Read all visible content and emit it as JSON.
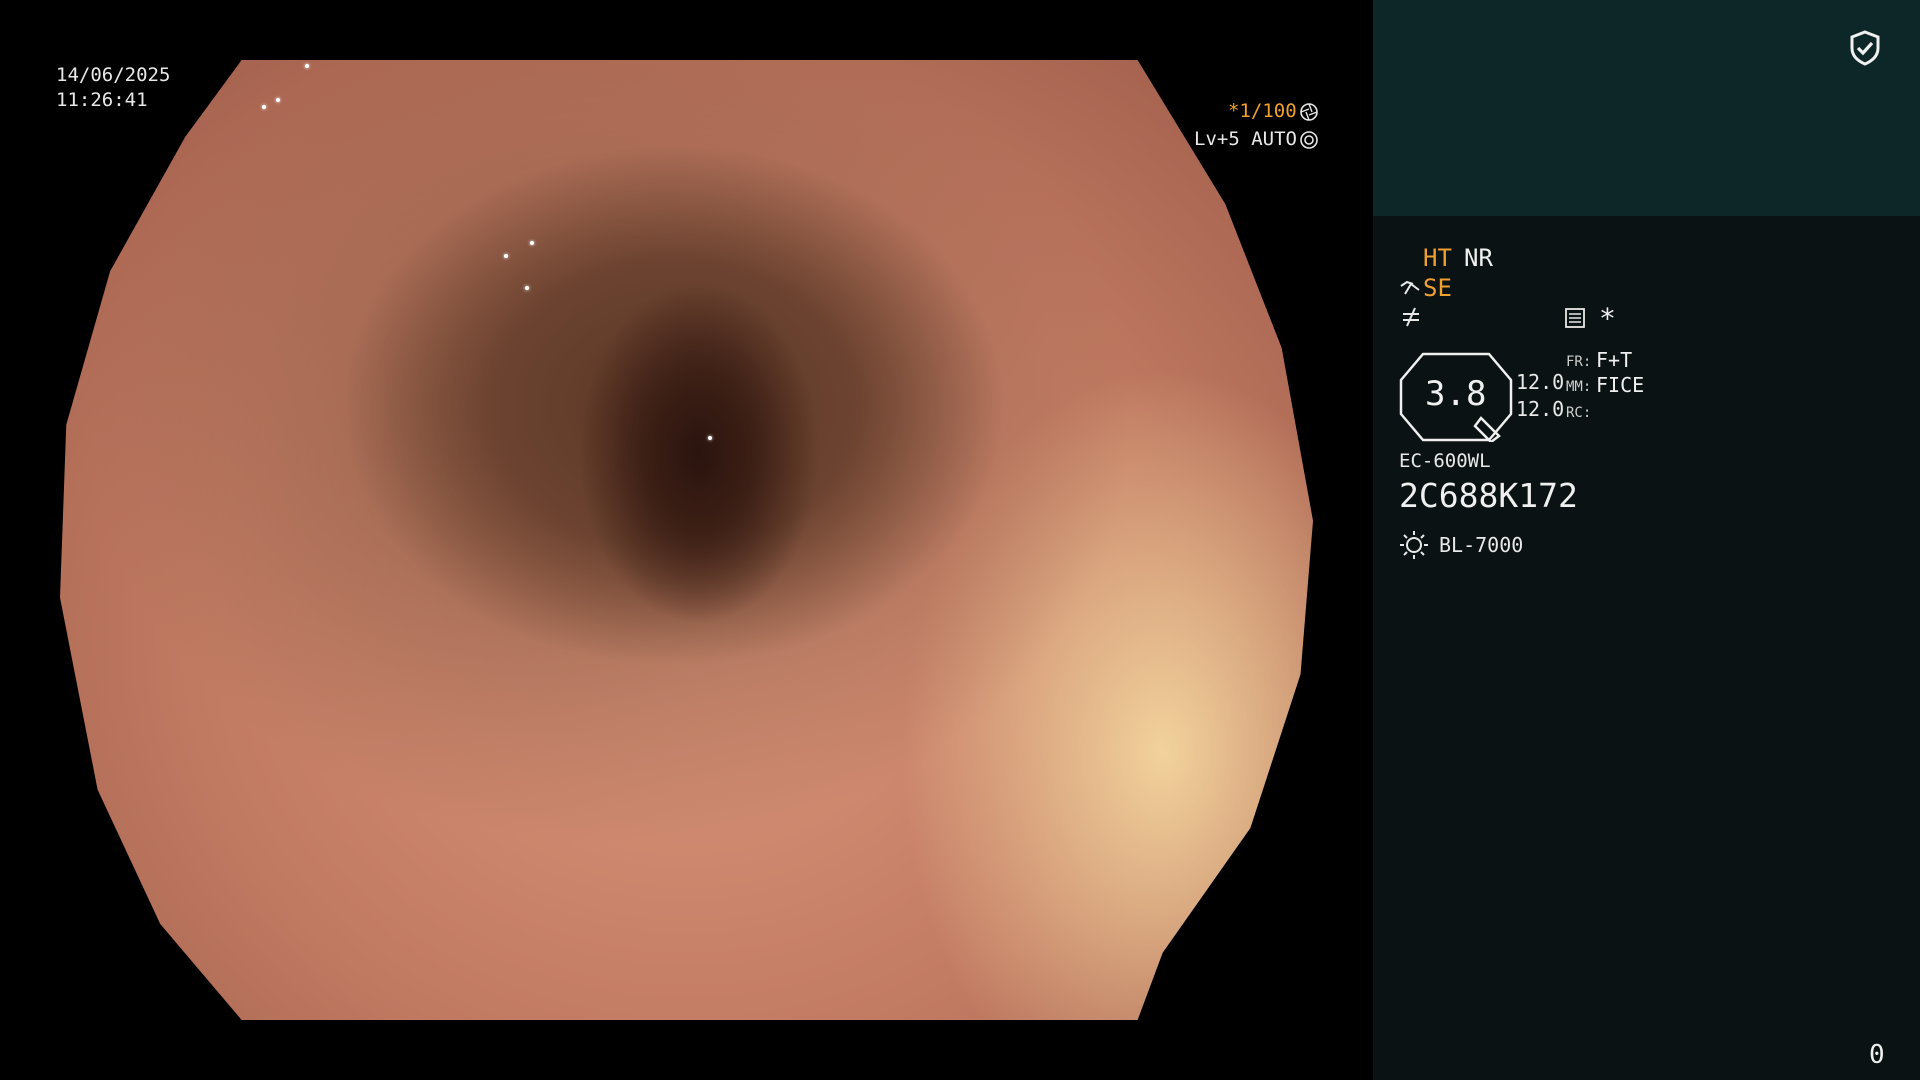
{
  "video": {
    "date": "14/06/2025",
    "time": "11:26:41",
    "shutter": "*1/100",
    "level": "Lv+5 AUTO"
  },
  "panel": {
    "ht": "HT",
    "nr": "NR",
    "se": "SE",
    "asterisk": "*",
    "gauge_value": "3.8",
    "val1": "12.0",
    "val2": "12.0",
    "fr_label": "FR:",
    "fr_value": "F+T",
    "mm_label": "MM:",
    "mm_value": "FICE",
    "rc_label": "RC:",
    "scope_model": "EC-600WL",
    "serial": "2C688K172",
    "light_source": "BL-7000",
    "counter": "0"
  },
  "icons": [
    "shield-check-icon",
    "aperture-icon",
    "light-ring-icon",
    "enhance-icon",
    "structure-icon",
    "settings-list-icon",
    "light-source-icon"
  ],
  "colors": {
    "accent": "#f0a030",
    "panel_bg": "#0a1214",
    "panel_top_bg": "#0d2628"
  }
}
